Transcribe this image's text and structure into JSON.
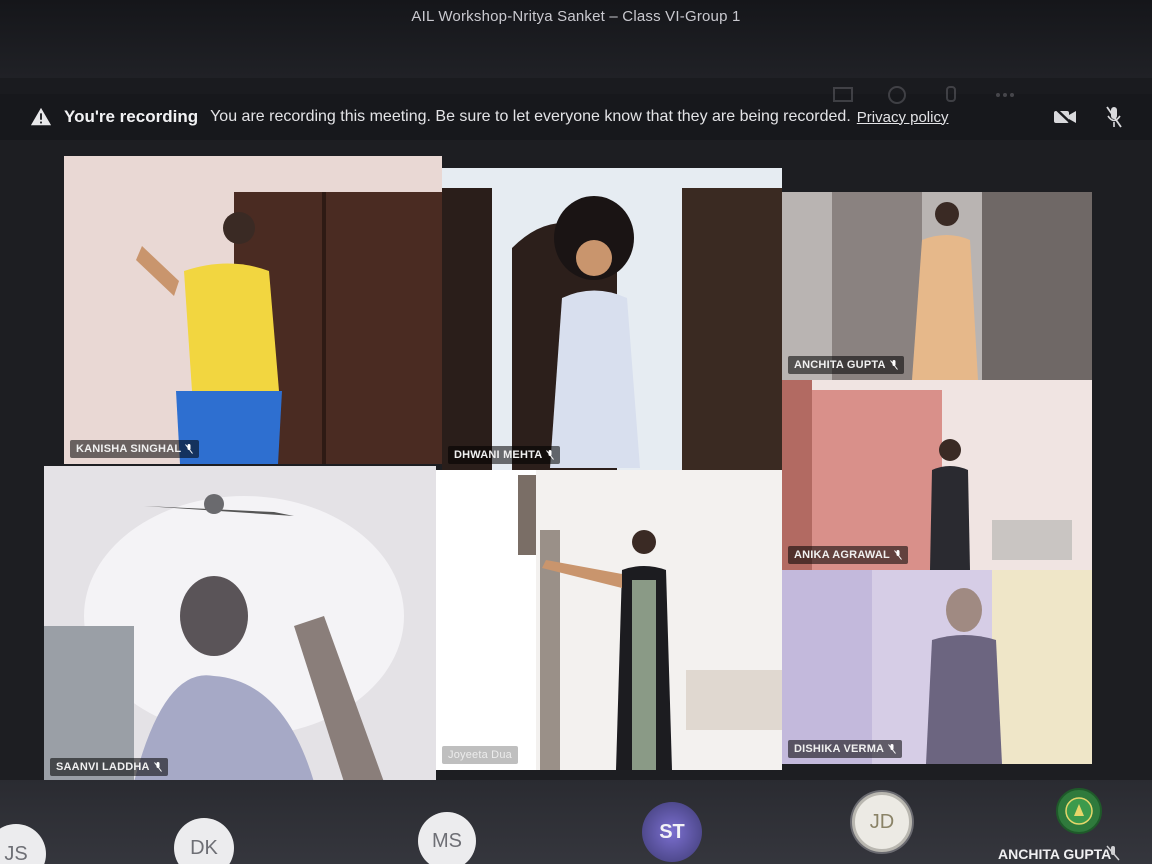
{
  "window": {
    "title": "AIL Workshop-Nritya Sanket – Class VI-Group 1"
  },
  "recording_banner": {
    "title": "You're recording",
    "message": "You are recording this meeting. Be sure to let everyone know that they are being recorded.",
    "link": "Privacy policy"
  },
  "toolbar": {
    "icons": [
      "video-off-icon",
      "mic-off-icon",
      "more-icon",
      "share-icon",
      "reactions-icon",
      "hand-icon"
    ]
  },
  "tiles": [
    {
      "name": "KANISHA SINGHAL",
      "muted": true
    },
    {
      "name": "DHWANI MEHTA",
      "muted": true
    },
    {
      "name": "ANCHITA GUPTA",
      "muted": true
    },
    {
      "name": "ANIKA AGRAWAL",
      "muted": true
    },
    {
      "name": "SAANVI LADDHA",
      "muted": true
    },
    {
      "name": "Joyeeta Dua",
      "muted": false
    },
    {
      "name": "DISHIKA VERMA",
      "muted": true
    }
  ],
  "participants_bar": {
    "avatars": [
      "JS",
      "DK",
      "MS",
      "ST",
      "JD"
    ],
    "active_name": "ANCHITA GUPTA"
  },
  "colors": {
    "background": "#1a1b1f",
    "banner": "#17181c",
    "st_avatar": "#7b6fd0"
  }
}
